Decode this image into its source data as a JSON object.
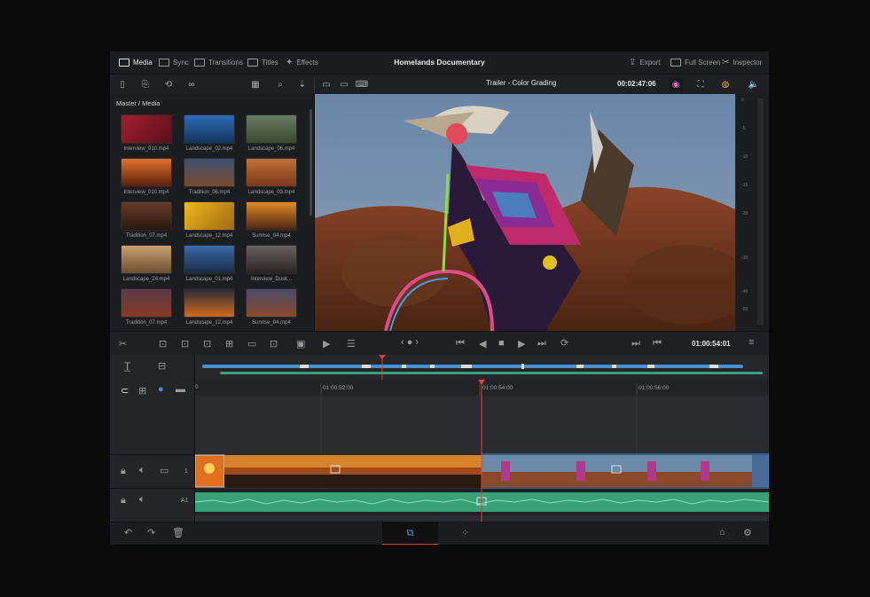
{
  "header": {
    "tabs": [
      {
        "label": "Media",
        "active": true
      },
      {
        "label": "Sync"
      },
      {
        "label": "Transitions"
      },
      {
        "label": "Titles"
      },
      {
        "label": "Effects"
      }
    ],
    "project_title": "Homelands Documentary",
    "right_actions": [
      {
        "label": "Export"
      },
      {
        "label": "Full Screen"
      },
      {
        "label": "Inspector"
      }
    ]
  },
  "media_pool": {
    "breadcrumb": "Master / Media",
    "clips": [
      {
        "name": "Interview_010.mp4",
        "color": "#8b1e2a"
      },
      {
        "name": "Landscape_02.mp4",
        "color": "#1f4f8c"
      },
      {
        "name": "Landscape_06.mp4",
        "color": "#4a5a3a"
      },
      {
        "name": "Interview_010.mp4",
        "color": "#c4541f"
      },
      {
        "name": "Tradition_06.mp4",
        "color": "#6a4a3a"
      },
      {
        "name": "Landscape_03.mp4",
        "color": "#b05a30"
      },
      {
        "name": "Tradition_07.mp4",
        "color": "#5a3224"
      },
      {
        "name": "Landscape_12.mp4",
        "color": "#d49a16"
      },
      {
        "name": "Sunrise_04.mp4",
        "color": "#b0641a"
      },
      {
        "name": "Landscape_24.mp4",
        "color": "#9a7a52"
      },
      {
        "name": "Landscape_01.mp4",
        "color": "#2a4b7a"
      },
      {
        "name": "Interview_Dusk...",
        "color": "#4a3b3a"
      },
      {
        "name": "Tradition_07.mp4",
        "color": "#7a3a2a"
      },
      {
        "name": "Landscape_12.mp4",
        "color": "#b0581a"
      },
      {
        "name": "Sunrise_04.mp4",
        "color": "#7a3f25"
      }
    ]
  },
  "viewer": {
    "clip_title": "Trailer - Color Grading",
    "timecode": "00:02:47:06",
    "meter_labels": [
      "0",
      "-5",
      "-10",
      "-15",
      "-20",
      "-30",
      "-40",
      "-50"
    ]
  },
  "transport": {
    "record_timecode": "01:00:54:01"
  },
  "timeline": {
    "ruler": [
      "01:00:52:00",
      "01:00:54:00",
      "01:00:56:00"
    ],
    "ruler_start": "0",
    "video_track_label": "1",
    "audio_track_label": "A1"
  },
  "colors": {
    "accent": "#4b8fd1",
    "playhead": "#e0403a",
    "audio_track": "#3aa07a"
  }
}
